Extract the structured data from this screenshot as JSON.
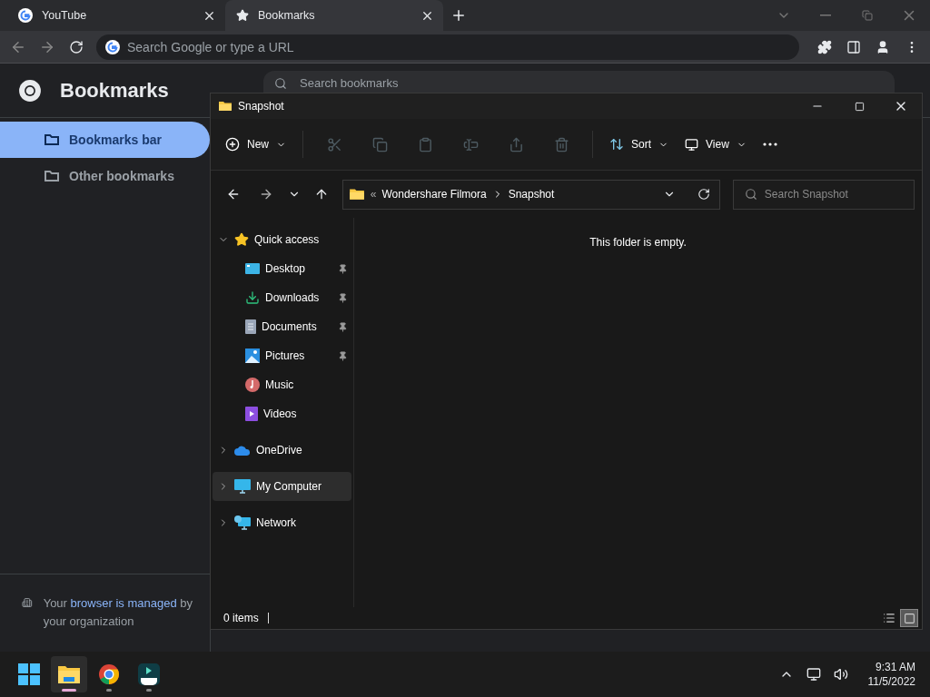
{
  "browser": {
    "tabs": [
      {
        "title": "YouTube",
        "kind": "google",
        "selected": false
      },
      {
        "title": "Bookmarks",
        "kind": "star",
        "selected": true
      }
    ],
    "omnibox": {
      "placeholder": "Search Google or type a URL"
    },
    "page": {
      "title": "Bookmarks",
      "search": {
        "placeholder": "Search bookmarks"
      },
      "sidebar": {
        "items": [
          {
            "label": "Bookmarks bar",
            "selected": true
          },
          {
            "label": "Other bookmarks",
            "selected": false
          }
        ]
      },
      "managed_notice": {
        "before": "Your",
        "link": "browser is managed",
        "after": "by your organization"
      }
    }
  },
  "explorer": {
    "window": {
      "title": "Snapshot"
    },
    "command_bar": {
      "new_label": "New",
      "tools": [
        {
          "kind": "cut",
          "disabled": true
        },
        {
          "kind": "copy",
          "disabled": true
        },
        {
          "kind": "paste",
          "disabled": true
        },
        {
          "kind": "rename",
          "disabled": true
        },
        {
          "kind": "share",
          "disabled": true
        },
        {
          "kind": "delete",
          "disabled": true
        }
      ],
      "sort_label": "Sort",
      "view_label": "View"
    },
    "address": {
      "overflow_marker": "«",
      "breadcrumb": [
        "Wondershare Filmora",
        "Snapshot"
      ],
      "search": {
        "placeholder": "Search Snapshot"
      }
    },
    "nav_tree": [
      {
        "label": "Quick access",
        "kind": "star",
        "expanded": true,
        "selected": false,
        "children": [
          {
            "label": "Desktop",
            "kind": "desktop",
            "pinned": true
          },
          {
            "label": "Downloads",
            "kind": "downloads",
            "pinned": true
          },
          {
            "label": "Documents",
            "kind": "documents",
            "pinned": true
          },
          {
            "label": "Pictures",
            "kind": "pictures",
            "pinned": true
          },
          {
            "label": "Music",
            "kind": "music",
            "pinned": false
          },
          {
            "label": "Videos",
            "kind": "videos",
            "pinned": false
          }
        ]
      },
      {
        "label": "OneDrive",
        "kind": "cloud",
        "expanded": false,
        "selected": false
      },
      {
        "label": "My Computer",
        "kind": "computer",
        "expanded": false,
        "selected": true
      },
      {
        "label": "Network",
        "kind": "network",
        "expanded": false,
        "selected": false
      }
    ],
    "empty_message": "This folder is empty.",
    "status_bar": {
      "count": "0 items",
      "views": [
        {
          "kind": "details",
          "selected": false
        },
        {
          "kind": "tiles",
          "selected": true
        }
      ]
    }
  },
  "taskbar": {
    "apps": [
      {
        "kind": "start",
        "active": false,
        "running": false
      },
      {
        "kind": "explorer",
        "active": true,
        "running": true
      },
      {
        "kind": "chrome",
        "active": false,
        "running": true
      },
      {
        "kind": "filmora",
        "active": false,
        "running": true
      }
    ],
    "clock": {
      "time": "9:31 AM",
      "date": "11/5/2022"
    }
  }
}
